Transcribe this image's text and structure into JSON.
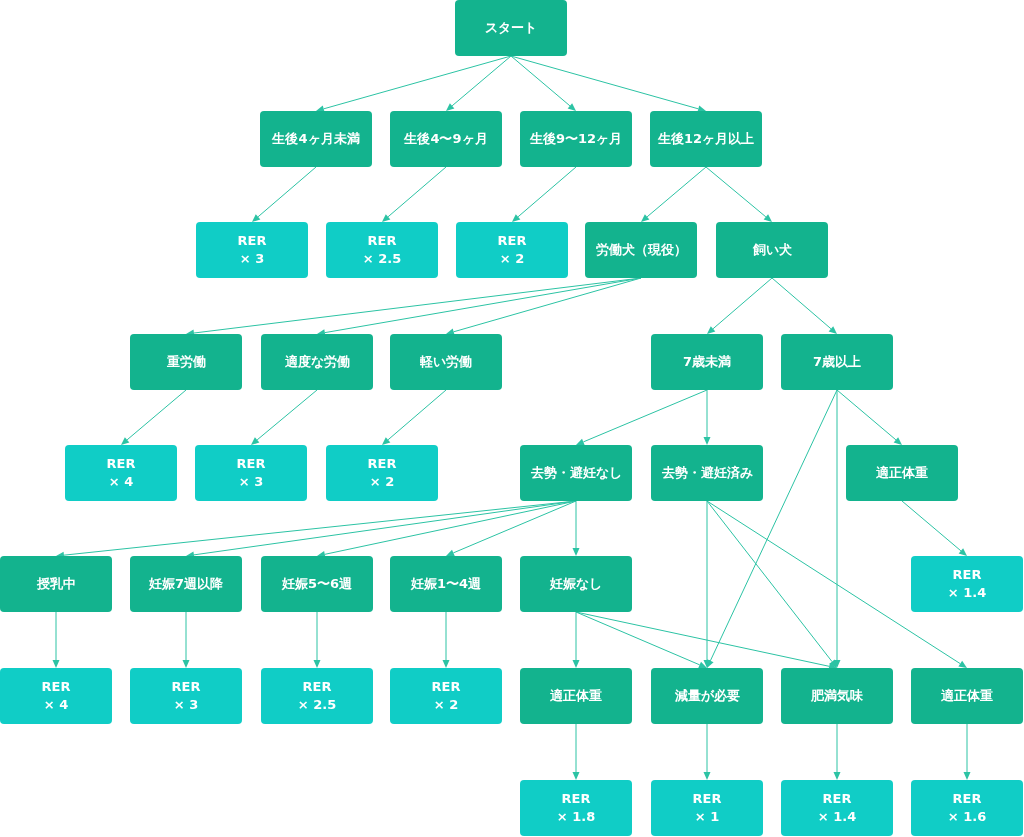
{
  "flowchart": {
    "nodes": [
      {
        "text": "スタート",
        "kind": "step"
      },
      {
        "text": "生後4ヶ月未満",
        "kind": "step"
      },
      {
        "text": "生後4〜9ヶ月",
        "kind": "step"
      },
      {
        "text": "生後9〜12ヶ月",
        "kind": "step"
      },
      {
        "text": "生後12ヶ月以上",
        "kind": "step"
      },
      {
        "text": "RER\n× 3",
        "kind": "result"
      },
      {
        "text": "RER\n× 2.5",
        "kind": "result"
      },
      {
        "text": "RER\n× 2",
        "kind": "result"
      },
      {
        "text": "労働犬（現役）",
        "kind": "step"
      },
      {
        "text": "飼い犬",
        "kind": "step"
      },
      {
        "text": "重労働",
        "kind": "step"
      },
      {
        "text": "適度な労働",
        "kind": "step"
      },
      {
        "text": "軽い労働",
        "kind": "step"
      },
      {
        "text": "7歳未満",
        "kind": "step"
      },
      {
        "text": "7歳以上",
        "kind": "step"
      },
      {
        "text": "RER\n× 4",
        "kind": "result"
      },
      {
        "text": "RER\n× 3",
        "kind": "result"
      },
      {
        "text": "RER\n× 2",
        "kind": "result"
      },
      {
        "text": "去勢・避妊なし",
        "kind": "step"
      },
      {
        "text": "去勢・避妊済み",
        "kind": "step"
      },
      {
        "text": "適正体重",
        "kind": "step"
      },
      {
        "text": "授乳中",
        "kind": "step"
      },
      {
        "text": "妊娠7週以降",
        "kind": "step"
      },
      {
        "text": "妊娠5〜6週",
        "kind": "step"
      },
      {
        "text": "妊娠1〜4週",
        "kind": "step"
      },
      {
        "text": "妊娠なし",
        "kind": "step"
      },
      {
        "text": "RER\n× 1.4",
        "kind": "result"
      },
      {
        "text": "RER\n× 4",
        "kind": "result"
      },
      {
        "text": "RER\n× 3",
        "kind": "result"
      },
      {
        "text": "RER\n× 2.5",
        "kind": "result"
      },
      {
        "text": "RER\n× 2",
        "kind": "result"
      },
      {
        "text": "適正体重",
        "kind": "step"
      },
      {
        "text": "減量が必要",
        "kind": "step"
      },
      {
        "text": "肥満気味",
        "kind": "step"
      },
      {
        "text": "適正体重",
        "kind": "step"
      },
      {
        "text": "RER\n× 1.8",
        "kind": "result"
      },
      {
        "text": "RER\n× 1",
        "kind": "result"
      },
      {
        "text": "RER\n× 1.4",
        "kind": "result"
      },
      {
        "text": "RER\n× 1.6",
        "kind": "result"
      }
    ]
  }
}
